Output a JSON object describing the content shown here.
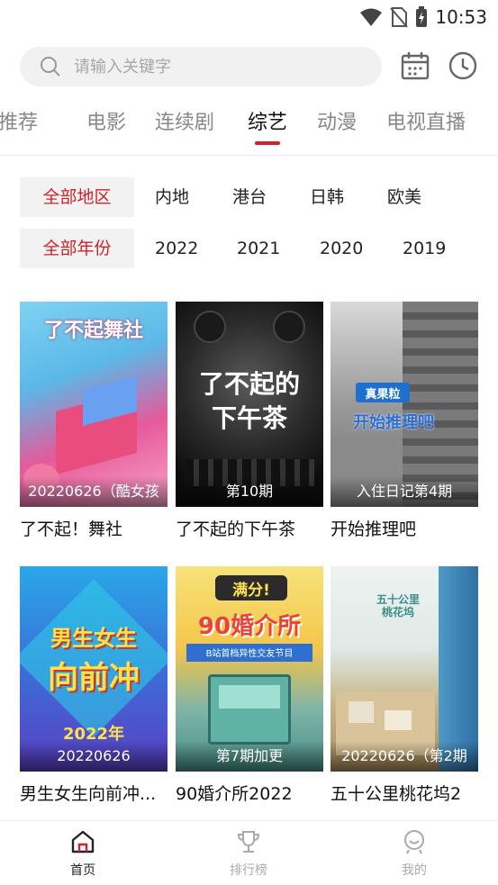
{
  "status_bar": {
    "time": "10:53"
  },
  "search": {
    "placeholder": "请输入关键字"
  },
  "tabs": [
    {
      "label": "推荐"
    },
    {
      "label": "电影"
    },
    {
      "label": "连续剧"
    },
    {
      "label": "综艺",
      "active": true
    },
    {
      "label": "动漫"
    },
    {
      "label": "电视直播"
    }
  ],
  "filters": {
    "region": {
      "selected": "全部地区",
      "options": [
        "内地",
        "港台",
        "日韩",
        "欧美"
      ]
    },
    "year": {
      "selected": "全部年份",
      "options": [
        "2022",
        "2021",
        "2020",
        "2019"
      ]
    }
  },
  "posters": [
    {
      "title": "了不起！舞社",
      "caption": "20220626（酷女孩",
      "art_text": "了不起舞社"
    },
    {
      "title": "了不起的下午茶",
      "caption": "第10期",
      "art_text_1": "了不起的",
      "art_text_2": "下午茶"
    },
    {
      "title": "开始推理吧",
      "caption": "入住日记第4期",
      "art_text_1": "真果粒",
      "art_text_2": "开始推理吧"
    },
    {
      "title": "男生女生向前冲...",
      "caption": "20220626",
      "art_text_1": "男生女生",
      "art_text_2": "向前冲",
      "art_text_3": "2022年"
    },
    {
      "title": "90婚介所2022",
      "caption": "第7期加更",
      "art_text_1": "满分!",
      "art_text_2": "90婚介所",
      "art_text_3": "B站首档异性交友节目"
    },
    {
      "title": "五十公里桃花坞2",
      "caption": "20220626（第2期",
      "art_text": "五十公里桃花坞"
    }
  ],
  "bottom_nav": [
    {
      "label": "首页",
      "active": true
    },
    {
      "label": "排行榜"
    },
    {
      "label": "我的"
    }
  ],
  "colors": {
    "accent": "#d3202a",
    "inactive": "#aaaaaa"
  }
}
